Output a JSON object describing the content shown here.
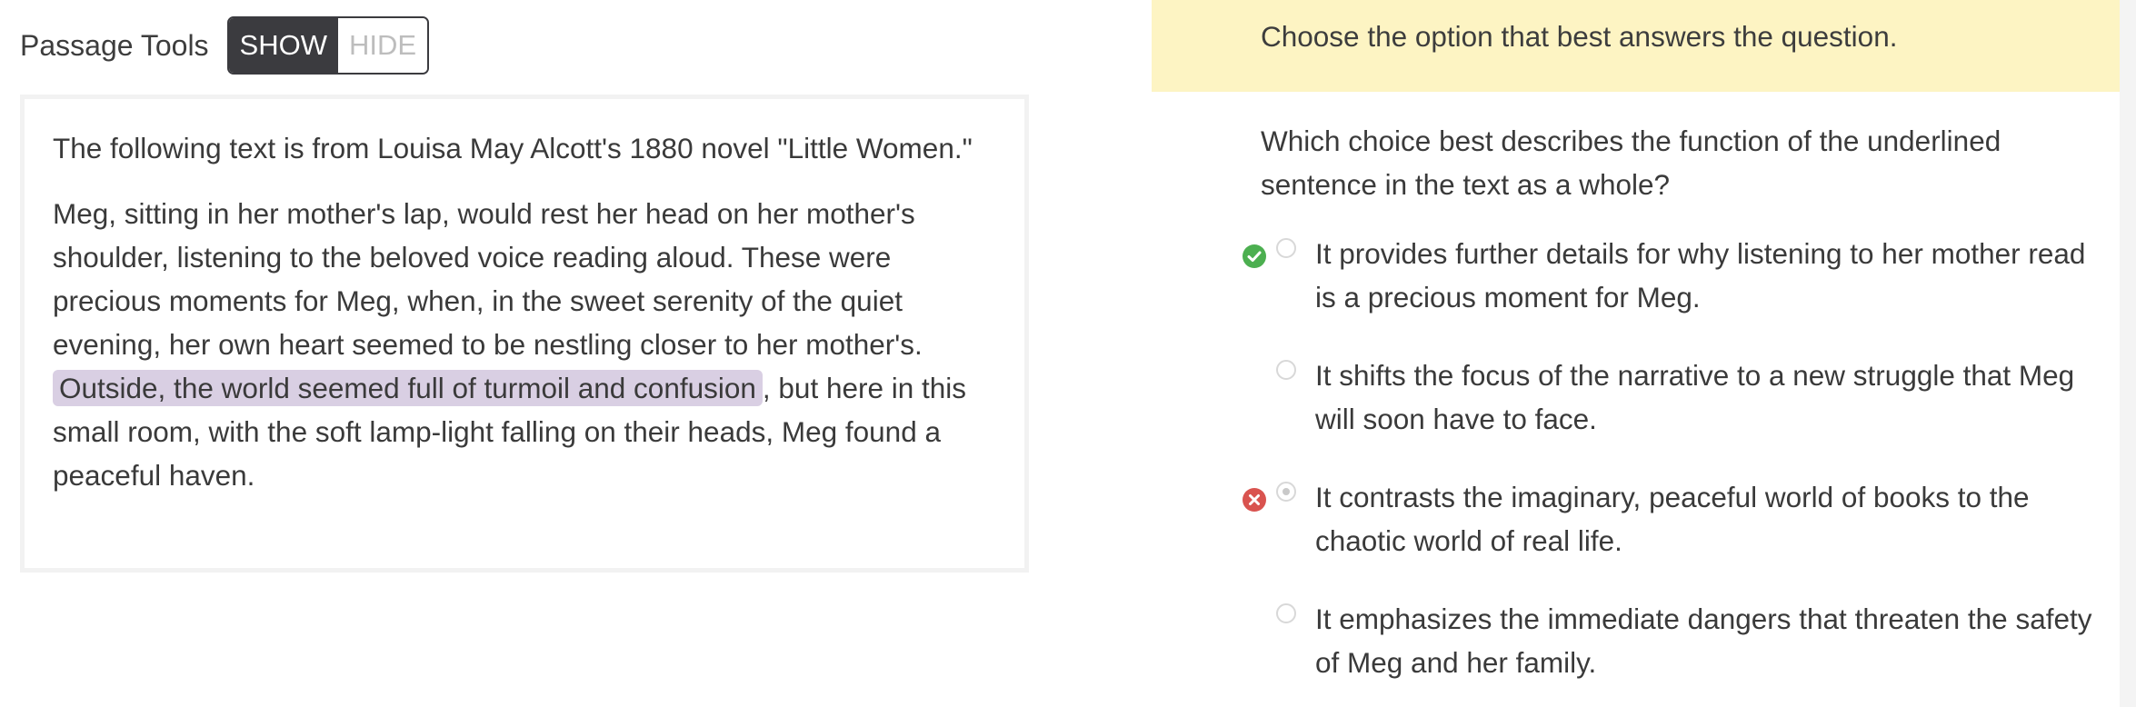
{
  "passage_tools": {
    "label": "Passage Tools",
    "show_label": "SHOW",
    "hide_label": "HIDE",
    "active": "SHOW"
  },
  "passage": {
    "intro": "The following text is from Louisa May Alcott's 1880 novel \"Little Women.\"",
    "body_before": "Meg, sitting in her mother's lap, would rest her head on her mother's shoulder, listening to the beloved voice reading aloud. These were precious moments for Meg, when, in the sweet serenity of the quiet evening, her own heart seemed to be nestling closer to her mother's. ",
    "underlined_sentence": "Outside, the world seemed full of turmoil and confusion",
    "body_after": ", but here in this small room, with the soft lamp-light falling on their heads, Meg found a peaceful haven."
  },
  "instruction": "Choose the option that best answers the question.",
  "question": "Which choice best describes the function of the underlined sentence in the text as a whole?",
  "options": [
    {
      "text": "It provides further details for why listening to her mother read is a precious moment for Meg.",
      "status": "correct",
      "selected": false
    },
    {
      "text": "It shifts the focus of the narrative to a new struggle that Meg will soon have to face.",
      "status": "none",
      "selected": false
    },
    {
      "text": "It contrasts the imaginary, peaceful world of books to the chaotic world of real life.",
      "status": "incorrect",
      "selected": true
    },
    {
      "text": "It emphasizes the immediate dangers that threaten the safety of Meg and her family.",
      "status": "none",
      "selected": false
    }
  ],
  "colors": {
    "toggle_active_bg": "#3b3b3f",
    "highlight_bg": "#d9cfe3",
    "instruction_bg": "#fdf4c3",
    "correct": "#4caf50",
    "incorrect": "#d9534f"
  },
  "icons": {
    "correct": "check-circle-icon",
    "incorrect": "x-circle-icon"
  }
}
